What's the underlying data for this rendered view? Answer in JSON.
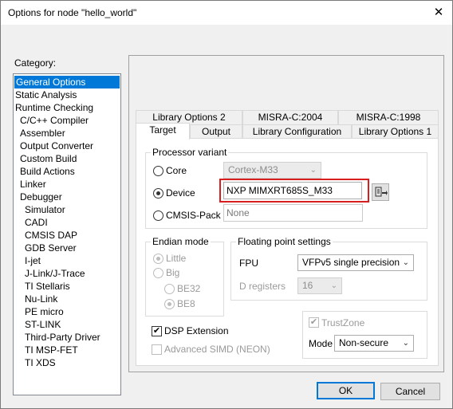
{
  "window": {
    "title": "Options for node \"hello_world\"",
    "close_glyph": "✕"
  },
  "category": {
    "label": "Category:",
    "items": [
      {
        "label": "General Options",
        "level": 0,
        "selected": true
      },
      {
        "label": "Static Analysis",
        "level": 0
      },
      {
        "label": "Runtime Checking",
        "level": 0
      },
      {
        "label": "C/C++ Compiler",
        "level": 1
      },
      {
        "label": "Assembler",
        "level": 1
      },
      {
        "label": "Output Converter",
        "level": 1
      },
      {
        "label": "Custom Build",
        "level": 1
      },
      {
        "label": "Build Actions",
        "level": 1
      },
      {
        "label": "Linker",
        "level": 1
      },
      {
        "label": "Debugger",
        "level": 1
      },
      {
        "label": "Simulator",
        "level": 2
      },
      {
        "label": "CADI",
        "level": 2
      },
      {
        "label": "CMSIS DAP",
        "level": 2
      },
      {
        "label": "GDB Server",
        "level": 2
      },
      {
        "label": "I-jet",
        "level": 2
      },
      {
        "label": "J-Link/J-Trace",
        "level": 2
      },
      {
        "label": "TI Stellaris",
        "level": 2
      },
      {
        "label": "Nu-Link",
        "level": 2
      },
      {
        "label": "PE micro",
        "level": 2
      },
      {
        "label": "ST-LINK",
        "level": 2
      },
      {
        "label": "Third-Party Driver",
        "level": 2
      },
      {
        "label": "TI MSP-FET",
        "level": 2
      },
      {
        "label": "TI XDS",
        "level": 2
      }
    ]
  },
  "tabs": {
    "back_row": [
      "Library Options 2",
      "MISRA-C:2004",
      "MISRA-C:1998"
    ],
    "front_row": [
      "Target",
      "Output",
      "Library Configuration",
      "Library Options 1"
    ],
    "active": "Target"
  },
  "processor_variant": {
    "title": "Processor variant",
    "core_label": "Core",
    "core_value": "Cortex-M33",
    "device_label": "Device",
    "device_value": "NXP MIMXRT685S_M33",
    "cmsis_label": "CMSIS-Pack",
    "cmsis_value": "None",
    "selected": "Device"
  },
  "endian": {
    "title": "Endian mode",
    "little": "Little",
    "big": "Big",
    "be32": "BE32",
    "be8": "BE8"
  },
  "floating_point": {
    "title": "Floating point settings",
    "fpu_label": "FPU",
    "fpu_value": "VFPv5 single precision",
    "dregs_label": "D registers",
    "dregs_value": "16"
  },
  "dsp_extension": {
    "label": "DSP Extension",
    "checked": true
  },
  "advanced_simd": {
    "label": "Advanced SIMD (NEON)",
    "checked": false
  },
  "trustzone": {
    "label": "TrustZone",
    "checked": true,
    "mode_label": "Mode",
    "mode_value": "Non-secure"
  },
  "buttons": {
    "ok": "OK",
    "cancel": "Cancel"
  },
  "colors": {
    "selection": "#0078d7",
    "highlight_box": "#d81e1e"
  }
}
